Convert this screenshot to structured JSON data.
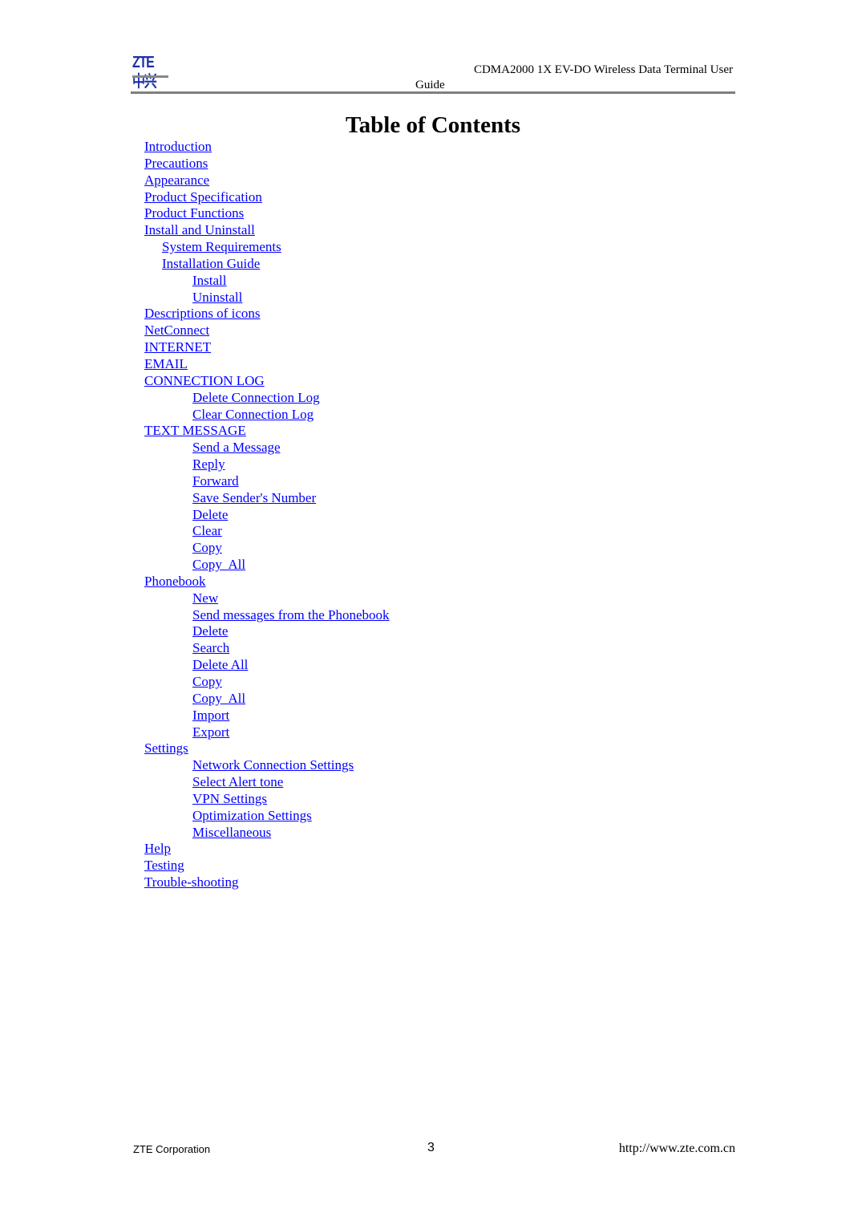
{
  "header": {
    "logo_text": "ZTE中兴",
    "title_line1": "CDMA2000 1X EV-DO Wireless Data Terminal User",
    "title_line2": "Guide"
  },
  "page_title": "Table of Contents",
  "link_color": "#0000ff",
  "toc": [
    {
      "label": "Introduction",
      "level": 1
    },
    {
      "label": "Precautions",
      "level": 1
    },
    {
      "label": "Appearance",
      "level": 1
    },
    {
      "label": "Product Specification",
      "level": 1
    },
    {
      "label": "Product Functions",
      "level": 1
    },
    {
      "label": "Install and Uninstall",
      "level": 1
    },
    {
      "label": "System Requirements",
      "level": 2
    },
    {
      "label": "Installation Guide",
      "level": 2
    },
    {
      "label": "Install",
      "level": 3
    },
    {
      "label": "Uninstall",
      "level": 3
    },
    {
      "label": "Descriptions of icons",
      "level": 1
    },
    {
      "label": "NetConnect",
      "level": 1
    },
    {
      "label": "INTERNET",
      "level": 1
    },
    {
      "label": "EMAIL",
      "level": 1
    },
    {
      "label": "CONNECTION LOG",
      "level": 1
    },
    {
      "label": "Delete Connection Log",
      "level": 3
    },
    {
      "label": "Clear Connection Log",
      "level": 3
    },
    {
      "label": "TEXT MESSAGE",
      "level": 1
    },
    {
      "label": "Send a Message",
      "level": 3
    },
    {
      "label": "Reply",
      "level": 3
    },
    {
      "label": "Forward",
      "level": 3
    },
    {
      "label": "Save Sender's Number",
      "level": 3
    },
    {
      "label": "Delete",
      "level": 3
    },
    {
      "label": "Clear",
      "level": 3
    },
    {
      "label": "Copy",
      "level": 3
    },
    {
      "label": "Copy  All",
      "level": 3
    },
    {
      "label": "Phonebook",
      "level": 1
    },
    {
      "label": "New",
      "level": 3
    },
    {
      "label": "Send messages from the Phonebook",
      "level": 3
    },
    {
      "label": "Delete",
      "level": 3
    },
    {
      "label": "Search",
      "level": 3
    },
    {
      "label": "Delete All",
      "level": 3
    },
    {
      "label": "Copy",
      "level": 3
    },
    {
      "label": "Copy  All",
      "level": 3
    },
    {
      "label": "Import",
      "level": 3
    },
    {
      "label": "Export",
      "level": 3
    },
    {
      "label": "Settings",
      "level": 1
    },
    {
      "label": "Network Connection Settings",
      "level": 3
    },
    {
      "label": "Select Alert tone",
      "level": 3
    },
    {
      "label": "VPN Settings",
      "level": 3
    },
    {
      "label": "Optimization Settings",
      "level": 3
    },
    {
      "label": "Miscellaneous",
      "level": 3
    },
    {
      "label": "Help",
      "level": 1
    },
    {
      "label": "Testing",
      "level": 1
    },
    {
      "label": "Trouble-shooting",
      "level": 1
    }
  ],
  "footer": {
    "company": "ZTE Corporation",
    "page_number": "3",
    "url": "http://www.zte.com.cn"
  }
}
